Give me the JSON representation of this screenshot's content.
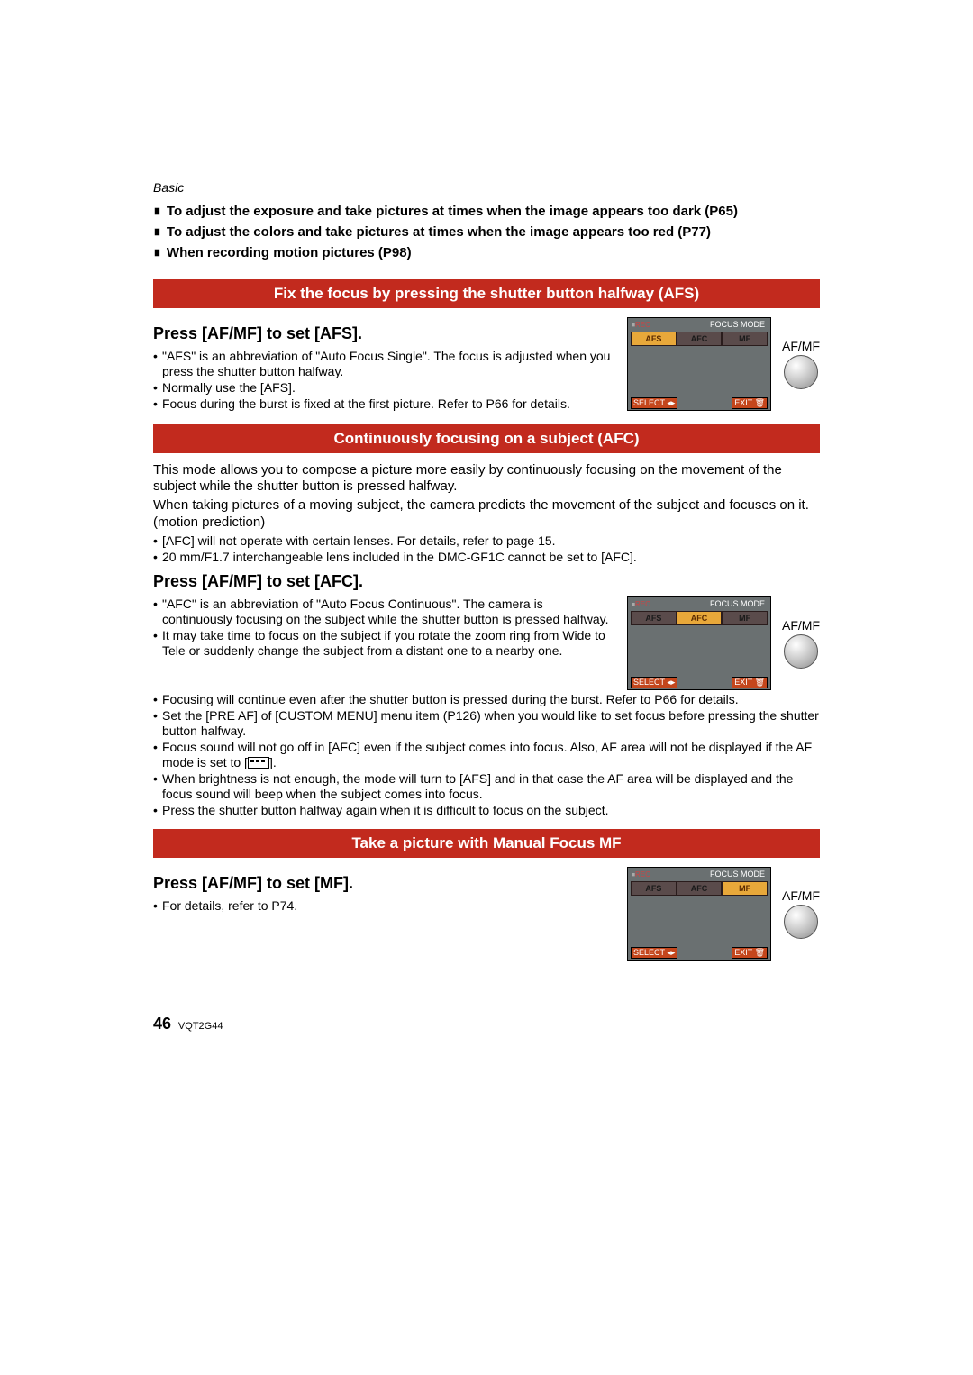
{
  "header": {
    "section": "Basic"
  },
  "top_bullets": [
    "To adjust the exposure and take pictures at times when the image appears too dark (P65)",
    "To adjust the colors and take pictures at times when the image appears too red (P77)",
    "When recording motion pictures (P98)"
  ],
  "afs": {
    "bar_title": "Fix the focus by pressing the shutter button halfway (AFS)",
    "instruction": "Press [AF/MF] to set [AFS].",
    "bullets": [
      "\"AFS\" is an abbreviation of \"Auto Focus Single\". The focus is adjusted when you press the shutter button halfway.",
      "Normally use the [AFS].",
      "Focus during the burst is fixed at the first picture. Refer to P66 for details."
    ],
    "screen": {
      "title": "FOCUS MODE",
      "modes": [
        "AFS",
        "AFC",
        "MF"
      ],
      "active_index": 0,
      "select_label": "SELECT",
      "exit_label": "EXIT"
    },
    "dial_label": "AF/MF"
  },
  "afc": {
    "bar_title": "Continuously focusing on a subject (AFC)",
    "intro_lines": [
      "This mode allows you to compose a picture more easily by continuously focusing on the movement of the subject while the shutter button is pressed halfway.",
      "When taking pictures of a moving subject, the camera predicts the movement of the subject and focuses on it. (motion prediction)"
    ],
    "intro_bullets": [
      "[AFC] will not operate with certain lenses. For details, refer to page 15.",
      "20 mm/F1.7 interchangeable lens included in the DMC-GF1C cannot be set to [AFC]."
    ],
    "instruction": "Press [AF/MF] to set [AFC].",
    "fig_bullets": [
      "\"AFC\" is an abbreviation of \"Auto Focus Continuous\". The camera is continuously focusing on the subject while the shutter button is pressed halfway.",
      "It may take time to focus on the subject if you rotate the zoom ring from Wide to Tele or suddenly change the subject from a distant one to a nearby one."
    ],
    "after_bullets": [
      "Focusing will continue even after the shutter button is pressed during the burst. Refer to P66 for details.",
      "Set the [PRE AF] of [CUSTOM MENU] menu item (P126) when you would like to set focus before pressing the shutter button halfway.",
      "Focus sound will not go off in [AFC] even if the subject comes into focus. Also, AF area will not be displayed if the AF mode is set to [___].",
      "When brightness is not enough, the mode will turn to [AFS] and in that case the AF area will be displayed and the focus sound will beep when the subject comes into focus.",
      "Press the shutter button halfway again when it is difficult to focus on the subject."
    ],
    "screen": {
      "title": "FOCUS MODE",
      "modes": [
        "AFS",
        "AFC",
        "MF"
      ],
      "active_index": 1,
      "select_label": "SELECT",
      "exit_label": "EXIT"
    },
    "dial_label": "AF/MF"
  },
  "mf": {
    "bar_title": "Take a picture with Manual Focus MF",
    "instruction": "Press [AF/MF] to set [MF].",
    "bullets": [
      "For details, refer to P74."
    ],
    "screen": {
      "title": "FOCUS MODE",
      "modes": [
        "AFS",
        "AFC",
        "MF"
      ],
      "active_index": 2,
      "select_label": "SELECT",
      "exit_label": "EXIT"
    },
    "dial_label": "AF/MF"
  },
  "footer": {
    "page": "46",
    "doc_id": "VQT2G44"
  }
}
